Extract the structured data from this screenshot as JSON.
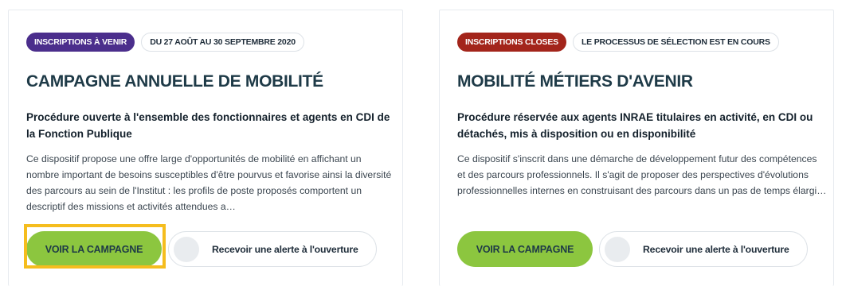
{
  "colors": {
    "badge_upcoming": "#4b2e8c",
    "badge_closed": "#a3251b",
    "cta_green": "#8cc63f",
    "highlight_yellow": "#f5bd1e",
    "title_dark": "#1e3a47"
  },
  "cards": [
    {
      "status_badge": "INSCRIPTIONS À VENIR",
      "info_pill": "DU 27 AOÛT AU 30 SEPTEMBRE 2020",
      "title": "CAMPAGNE ANNUELLE DE MOBILITÉ",
      "subtitle": "Procédure ouverte à l'ensemble des fonctionnaires et agents en CDI de la Fonction Publique",
      "description": "Ce dispositif propose une offre large d'opportunités de mobilité en affichant un nombre important de besoins susceptibles d'être pourvus et favorise ainsi la diversité des parcours au sein de l'Institut : les profils de poste proposés comportent un descriptif des missions et activités attendues a…",
      "cta_label": "VOIR LA CAMPAGNE",
      "alert_label": "Recevoir une alerte à l'ouverture"
    },
    {
      "status_badge": "INSCRIPTIONS CLOSES",
      "info_pill": "LE PROCESSUS DE SÉLECTION EST EN COURS",
      "title": "MOBILITÉ MÉTIERS D'AVENIR",
      "subtitle": "Procédure réservée aux agents INRAE titulaires en activité, en CDI ou détachés, mis à disposition ou en disponibilité",
      "description": "Ce dispositif s'inscrit dans une démarche de développement futur des compétences et des parcours professionnels. Il s'agit de proposer des perspectives d'évolutions professionnelles internes en construisant des parcours dans un pas de temps élargi…",
      "cta_label": "VOIR LA CAMPAGNE",
      "alert_label": "Recevoir une alerte à l'ouverture"
    }
  ]
}
